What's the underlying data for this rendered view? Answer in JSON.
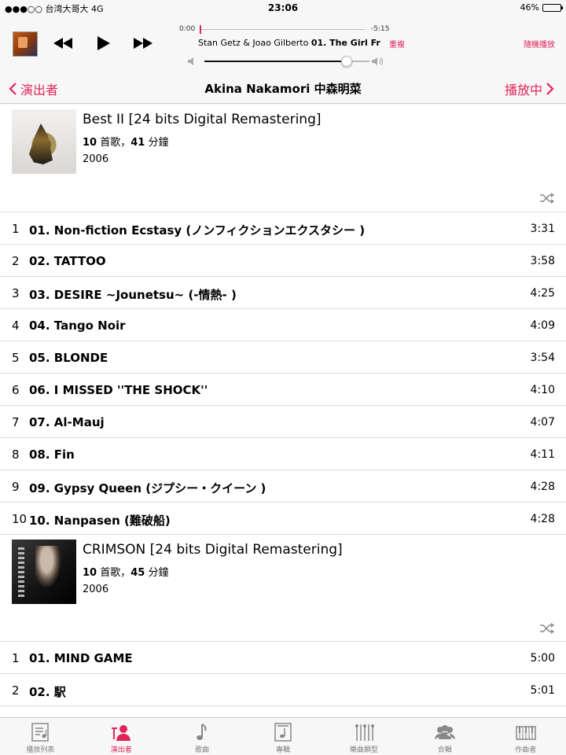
{
  "status": {
    "carrier": "●●●○○ 台湾大哥大  4G",
    "time": "23:06",
    "battery": "46%",
    "battery_level": 0.46
  },
  "now_playing": {
    "elapsed": "0:00",
    "remaining": "-5:15",
    "artist": "Stan Getz & Joao Gilberto",
    "track": "01. The Girl Fr",
    "repeat_label": "重複",
    "shuffle_label": "隨機播放",
    "progress": 0.0,
    "volume": 0.86
  },
  "nav": {
    "back_label": "演出者",
    "title": "Akina Nakamori 中森明菜",
    "right_label": "播放中"
  },
  "albums": [
    {
      "title": "Best II [24 bits Digital Remastering]",
      "song_count": "10",
      "song_unit": " 首歌，",
      "minutes": "41",
      "minute_unit": " 分鐘",
      "year": "2006",
      "tracks": [
        {
          "num": "1",
          "name": "01. Non-fiction Ecstasy (ノンフィクションエクスタシー )",
          "duration": "3:31"
        },
        {
          "num": "2",
          "name": "02. TATTOO",
          "duration": "3:58"
        },
        {
          "num": "3",
          "name": "03. DESIRE ~Jounetsu~ (-情熱- )",
          "duration": "4:25"
        },
        {
          "num": "4",
          "name": "04. Tango Noir",
          "duration": "4:09"
        },
        {
          "num": "5",
          "name": "05. BLONDE",
          "duration": "3:54"
        },
        {
          "num": "6",
          "name": "06. I MISSED ''THE SHOCK''",
          "duration": "4:10"
        },
        {
          "num": "7",
          "name": "07. Al-Mauj",
          "duration": "4:07"
        },
        {
          "num": "8",
          "name": "08. Fin",
          "duration": "4:11"
        },
        {
          "num": "9",
          "name": "09. Gypsy Queen (ジプシー・クイーン )",
          "duration": "4:28"
        },
        {
          "num": "10",
          "name": "10. Nanpasen (難破船)",
          "duration": "4:28"
        }
      ]
    },
    {
      "title": "CRIMSON [24 bits Digital Remastering]",
      "song_count": "10",
      "song_unit": " 首歌，",
      "minutes": "45",
      "minute_unit": " 分鐘",
      "year": "2006",
      "tracks": [
        {
          "num": "1",
          "name": "01. MIND GAME",
          "duration": "5:00"
        },
        {
          "num": "2",
          "name": "02. 駅",
          "duration": "5:01"
        }
      ]
    }
  ],
  "tabs": [
    {
      "label": "播放列表",
      "icon": "playlist-icon"
    },
    {
      "label": "演出者",
      "icon": "artist-icon"
    },
    {
      "label": "歌曲",
      "icon": "song-icon"
    },
    {
      "label": "專輯",
      "icon": "album-icon"
    },
    {
      "label": "樂曲類型",
      "icon": "genre-icon"
    },
    {
      "label": "合輯",
      "icon": "compilation-icon"
    },
    {
      "label": "作曲者",
      "icon": "composer-icon"
    }
  ],
  "colors": {
    "accent": "#e1245a"
  }
}
